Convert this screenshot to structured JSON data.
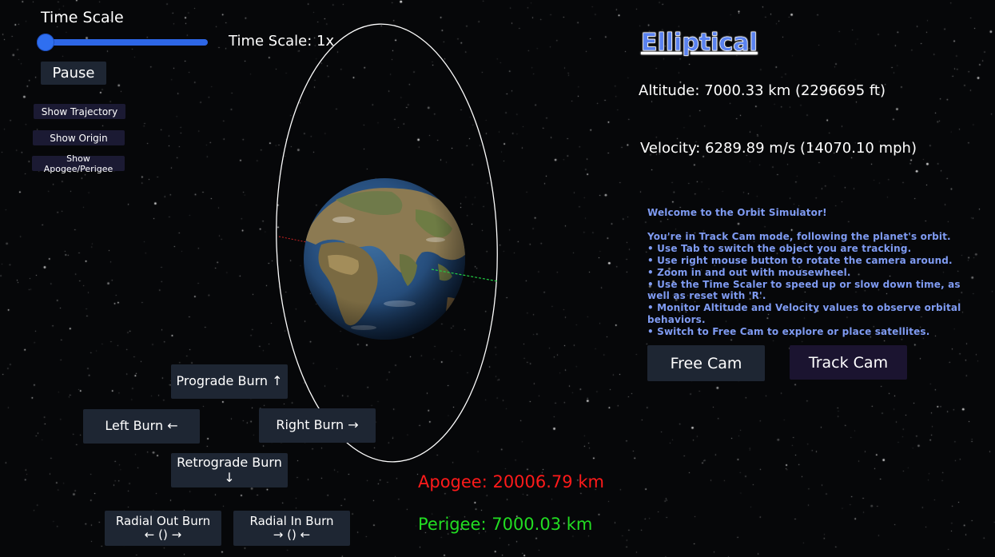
{
  "time_scale": {
    "title": "Time Scale",
    "readout": "Time Scale: 1x",
    "slider_level": 0
  },
  "controls": {
    "pause_label": "Pause",
    "show_trajectory_label": "Show Trajectory",
    "show_origin_label": "Show Origin",
    "show_apogee_perigee_label": "Show Apogee/Perigee"
  },
  "burns": {
    "prograde": "Prograde Burn ↑",
    "left": "Left Burn ←",
    "right": "Right Burn →",
    "retrograde": "Retrograde Burn ↓",
    "radial_out_line1": "Radial Out Burn",
    "radial_out_line2": "← () →",
    "radial_in_line1": "Radial In Burn",
    "radial_in_line2": "→ () ←"
  },
  "orbit": {
    "type": "Elliptical",
    "altitude": "Altitude: 7000.33 km (2296695 ft)",
    "velocity": "Velocity: 6289.89 m/s (14070.10 mph)",
    "apogee": "Apogee: 20006.79 km",
    "perigee": "Perigee: 7000.03 km"
  },
  "welcome": {
    "heading": "Welcome to the Orbit Simulator!",
    "intro": "You're in Track Cam mode, following the planet's orbit.",
    "tips": [
      "• Use Tab to switch the object you are tracking.",
      "• Use right mouse button to rotate the camera around.",
      "• Zoom in and out with mousewheel.",
      "• Use the Time Scaler to speed up or slow down time, as well as reset with 'R'.",
      "• Monitor Altitude and Velocity values to observe orbital behaviors.",
      "• Switch to Free Cam to explore or place satellites."
    ]
  },
  "camera": {
    "free_cam_label": "Free Cam",
    "track_cam_label": "Track Cam"
  },
  "colors": {
    "apogee": "#ff1a1a",
    "perigee": "#22dd22",
    "slider": "#2d66e6",
    "title": "#5a82f0",
    "welcome_text": "#7f9bf2"
  }
}
